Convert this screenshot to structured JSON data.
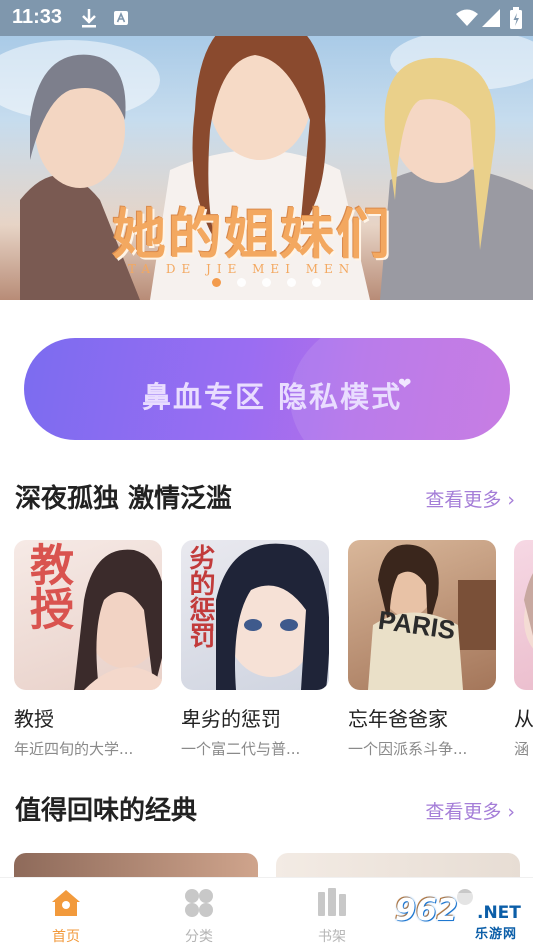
{
  "status_bar": {
    "time": "11:33",
    "icons": [
      "download-icon",
      "a-badge-icon",
      "wifi-icon",
      "signal-icon",
      "battery-icon"
    ]
  },
  "banner": {
    "title": "她的姐妹们",
    "subtitle": "TA DE JIE MEI MEN",
    "slide_count": 5,
    "active_slide": 1
  },
  "promo": {
    "label": "鼻血专区 隐私模式",
    "icon": "heart-icon"
  },
  "sections": [
    {
      "title": "深夜孤独 激情泛滥",
      "more_label": "查看更多 ›",
      "items": [
        {
          "name": "教授",
          "desc": "年近四旬的大学...",
          "cover_text": "教授"
        },
        {
          "name": "卑劣的惩罚",
          "desc": "一个富二代与普...",
          "cover_text": "劣的惩罚"
        },
        {
          "name": "忘年爸爸家",
          "desc": "一个因派系斗争...",
          "cover_text": "PARIS"
        },
        {
          "name": "从",
          "desc": "涵"
        }
      ]
    },
    {
      "title": "值得回味的经典",
      "more_label": "查看更多 ›"
    }
  ],
  "tabbar": {
    "tabs": [
      {
        "label": "首页",
        "icon": "home-icon",
        "active": true
      },
      {
        "label": "分类",
        "icon": "grid-icon",
        "active": false
      },
      {
        "label": "书架",
        "icon": "bookshelf-icon",
        "active": false
      },
      {
        "label": "",
        "icon": "profile-icon",
        "active": false
      }
    ]
  },
  "watermark": {
    "number": "962",
    "domain": ".NET",
    "name": "乐游网"
  },
  "colors": {
    "accent": "#f29a3c",
    "more_link": "#a57ed8",
    "promo_start": "#7b6cf0",
    "promo_end": "#c26fe0"
  }
}
